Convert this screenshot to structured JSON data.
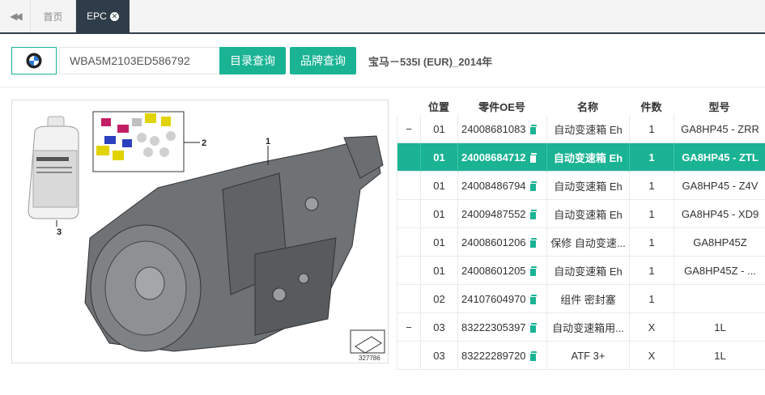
{
  "tabs": {
    "back_icon": "double-chevron-left-icon",
    "home": "首页",
    "epc": "EPC"
  },
  "search": {
    "brand_logo": "bmw-logo",
    "vin_value": "WBA5M2103ED586792",
    "catalog_btn": "目录查询",
    "brand_btn": "品牌查询",
    "vehicle": "宝马－535I (EUR)_2014年"
  },
  "illustration": {
    "callouts": [
      "1",
      "2",
      "3"
    ],
    "ref_number": "327786"
  },
  "table": {
    "headers": {
      "pos": "位置",
      "part": "零件OE号",
      "name": "名称",
      "qty": "件数",
      "model": "型号"
    },
    "rows": [
      {
        "toggle": "−",
        "pos": "01",
        "part": "24008681083",
        "name": "自动变速箱 Eh",
        "qty": "1",
        "model": "GA8HP45 - ZRR"
      },
      {
        "toggle": "",
        "pos": "01",
        "part": "24008684712",
        "name": "自动变速箱 Eh",
        "qty": "1",
        "model": "GA8HP45 - ZTL"
      },
      {
        "toggle": "",
        "pos": "01",
        "part": "24008486794",
        "name": "自动变速箱 Eh",
        "qty": "1",
        "model": "GA8HP45 - Z4V"
      },
      {
        "toggle": "",
        "pos": "01",
        "part": "24009487552",
        "name": "自动变速箱 Eh",
        "qty": "1",
        "model": "GA8HP45 - XD9"
      },
      {
        "toggle": "",
        "pos": "01",
        "part": "24008601206",
        "name": "保修 自动变速...",
        "qty": "1",
        "model": "GA8HP45Z"
      },
      {
        "toggle": "",
        "pos": "01",
        "part": "24008601205",
        "name": "自动变速箱 Eh",
        "qty": "1",
        "model": "GA8HP45Z - ..."
      },
      {
        "toggle": "",
        "pos": "02",
        "part": "24107604970",
        "name": "组件 密封塞",
        "qty": "1",
        "model": ""
      },
      {
        "toggle": "−",
        "pos": "03",
        "part": "83222305397",
        "name": "自动变速箱用...",
        "qty": "X",
        "model": "1L"
      },
      {
        "toggle": "",
        "pos": "03",
        "part": "83222289720",
        "name": "ATF 3+",
        "qty": "X",
        "model": "1L"
      }
    ],
    "selected_row": 1
  },
  "colors": {
    "accent": "#1ab394",
    "dark": "#2f3d4a"
  }
}
